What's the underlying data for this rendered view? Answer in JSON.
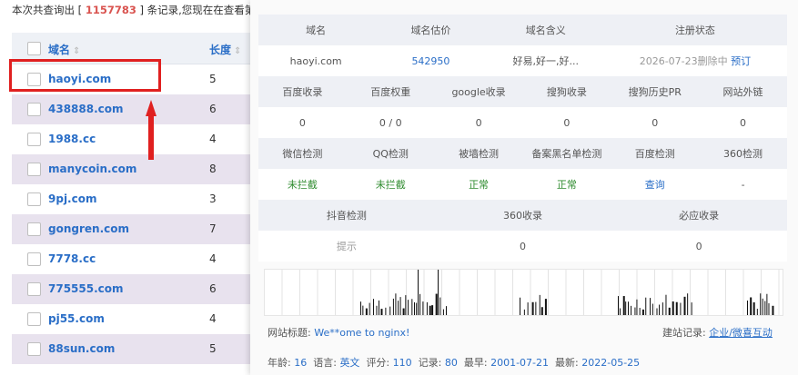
{
  "summary": {
    "prefix": "本次共查询出 [",
    "count": "1157783",
    "suffix": "] 条记录,您现在在查看第"
  },
  "table": {
    "headers": {
      "domain": "域名",
      "length": "长度",
      "sort_glyph": "⇕"
    },
    "rows": [
      {
        "domain": "haoyi.com",
        "length": "5"
      },
      {
        "domain": "438888.com",
        "length": "6"
      },
      {
        "domain": "1988.cc",
        "length": "4"
      },
      {
        "domain": "manycoin.com",
        "length": "8"
      },
      {
        "domain": "9pj.com",
        "length": "3"
      },
      {
        "domain": "gongren.com",
        "length": "7"
      },
      {
        "domain": "7778.cc",
        "length": "4"
      },
      {
        "domain": "775555.com",
        "length": "6"
      },
      {
        "domain": "pj55.com",
        "length": "4"
      },
      {
        "domain": "88sun.com",
        "length": "5"
      }
    ]
  },
  "detail": {
    "row1_head": [
      "域名",
      "域名估价",
      "域名含义",
      "注册状态"
    ],
    "row1_val": {
      "domain": "haoyi.com",
      "price": "542950",
      "meaning": "好易,好一,好...",
      "status": "2026-07-23删除中",
      "reserve": "预订"
    },
    "row2_head": [
      "百度收录",
      "百度权重",
      "google收录",
      "搜狗收录",
      "搜狗历史PR",
      "网站外链"
    ],
    "row2_val": [
      "0",
      "0 / 0",
      "0",
      "0",
      "0",
      "0"
    ],
    "row3_head": [
      "微信检测",
      "QQ检测",
      "被墙检测",
      "备案黑名单检测",
      "百度检测",
      "360检测"
    ],
    "row3_val": [
      "未拦截",
      "未拦截",
      "正常",
      "正常",
      "查询",
      "-"
    ],
    "row4_head": [
      "抖音检测",
      "360收录",
      "必应收录"
    ],
    "row4_val": [
      "提示",
      "0",
      "0"
    ],
    "site_title_label": "网站标题:",
    "site_title": "We**ome to nginx!",
    "record_label": "建站记录:",
    "record_value": "企业/微喜互动",
    "age_label": "年龄:",
    "age": "16",
    "lang_label": "语言:",
    "lang": "英文",
    "score_label": "评分:",
    "score": "110",
    "records_label": "记录:",
    "records": "80",
    "earliest_label": "最早:",
    "earliest": "2001-07-21",
    "latest_label": "最新:",
    "latest": "2022-05-25"
  },
  "colors": {
    "accent": "#2a6ec7",
    "highlight": "#e02020",
    "ok": "#2e8b2e"
  }
}
